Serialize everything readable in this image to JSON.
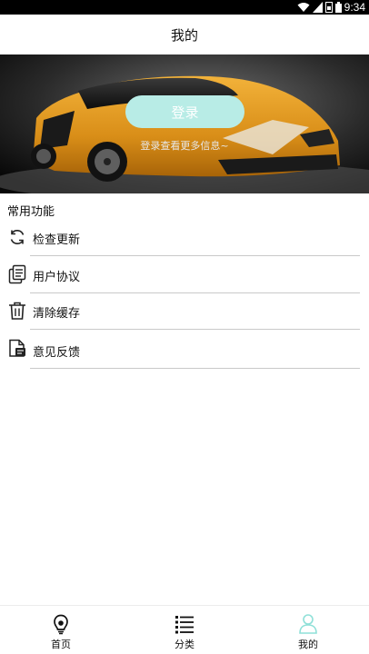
{
  "status_bar": {
    "time": "9:34",
    "icons": [
      "wifi-icon",
      "signal-icon",
      "sim-icon",
      "battery-icon"
    ]
  },
  "header": {
    "title": "我的"
  },
  "banner": {
    "login_label": "登录",
    "hint": "登录查看更多信息~"
  },
  "section": {
    "title": "常用功能"
  },
  "menu": {
    "items": [
      {
        "label": "检查更新",
        "icon": "refresh-icon"
      },
      {
        "label": "用户协议",
        "icon": "document-icon"
      },
      {
        "label": "清除缓存",
        "icon": "trash-icon"
      },
      {
        "label": "意见反馈",
        "icon": "feedback-icon"
      }
    ]
  },
  "tabbar": {
    "tabs": [
      {
        "label": "首页",
        "icon": "home-icon",
        "active": false
      },
      {
        "label": "分类",
        "icon": "list-icon",
        "active": false
      },
      {
        "label": "我的",
        "icon": "user-icon",
        "active": true
      }
    ]
  },
  "colors": {
    "accent": "#b8ece6",
    "active_icon": "#8fe0d8",
    "divider": "#c9c9c9"
  }
}
